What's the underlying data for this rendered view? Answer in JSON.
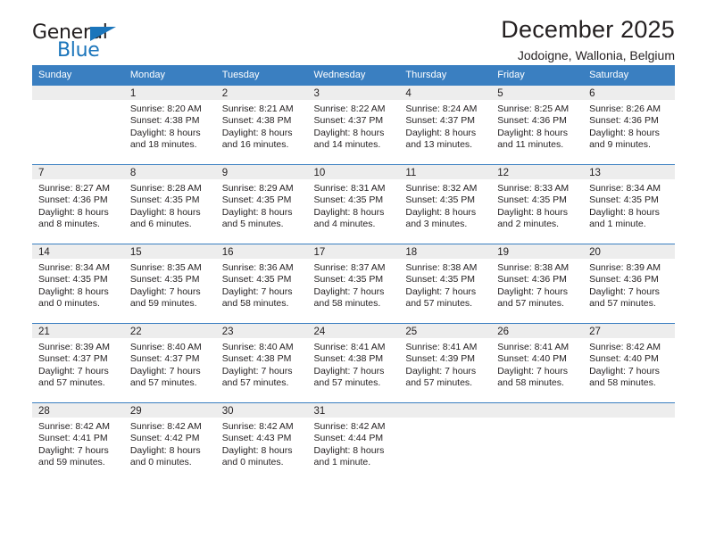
{
  "brand": {
    "name_top": "General",
    "name_bottom": "Blue",
    "triangle_color": "#1b75bb"
  },
  "header": {
    "title": "December 2025",
    "subtitle": "Jodoigne, Wallonia, Belgium"
  },
  "theme": {
    "header_row_bg": "#3a7fc1",
    "daynum_band_bg": "#ededed",
    "text_color": "#231f20"
  },
  "calendar": {
    "weekday_headers": [
      "Sunday",
      "Monday",
      "Tuesday",
      "Wednesday",
      "Thursday",
      "Friday",
      "Saturday"
    ],
    "weeks": [
      [
        {
          "day": "",
          "info": ""
        },
        {
          "day": "1",
          "info": "Sunrise: 8:20 AM\nSunset: 4:38 PM\nDaylight: 8 hours\nand 18 minutes."
        },
        {
          "day": "2",
          "info": "Sunrise: 8:21 AM\nSunset: 4:38 PM\nDaylight: 8 hours\nand 16 minutes."
        },
        {
          "day": "3",
          "info": "Sunrise: 8:22 AM\nSunset: 4:37 PM\nDaylight: 8 hours\nand 14 minutes."
        },
        {
          "day": "4",
          "info": "Sunrise: 8:24 AM\nSunset: 4:37 PM\nDaylight: 8 hours\nand 13 minutes."
        },
        {
          "day": "5",
          "info": "Sunrise: 8:25 AM\nSunset: 4:36 PM\nDaylight: 8 hours\nand 11 minutes."
        },
        {
          "day": "6",
          "info": "Sunrise: 8:26 AM\nSunset: 4:36 PM\nDaylight: 8 hours\nand 9 minutes."
        }
      ],
      [
        {
          "day": "7",
          "info": "Sunrise: 8:27 AM\nSunset: 4:36 PM\nDaylight: 8 hours\nand 8 minutes."
        },
        {
          "day": "8",
          "info": "Sunrise: 8:28 AM\nSunset: 4:35 PM\nDaylight: 8 hours\nand 6 minutes."
        },
        {
          "day": "9",
          "info": "Sunrise: 8:29 AM\nSunset: 4:35 PM\nDaylight: 8 hours\nand 5 minutes."
        },
        {
          "day": "10",
          "info": "Sunrise: 8:31 AM\nSunset: 4:35 PM\nDaylight: 8 hours\nand 4 minutes."
        },
        {
          "day": "11",
          "info": "Sunrise: 8:32 AM\nSunset: 4:35 PM\nDaylight: 8 hours\nand 3 minutes."
        },
        {
          "day": "12",
          "info": "Sunrise: 8:33 AM\nSunset: 4:35 PM\nDaylight: 8 hours\nand 2 minutes."
        },
        {
          "day": "13",
          "info": "Sunrise: 8:34 AM\nSunset: 4:35 PM\nDaylight: 8 hours\nand 1 minute."
        }
      ],
      [
        {
          "day": "14",
          "info": "Sunrise: 8:34 AM\nSunset: 4:35 PM\nDaylight: 8 hours\nand 0 minutes."
        },
        {
          "day": "15",
          "info": "Sunrise: 8:35 AM\nSunset: 4:35 PM\nDaylight: 7 hours\nand 59 minutes."
        },
        {
          "day": "16",
          "info": "Sunrise: 8:36 AM\nSunset: 4:35 PM\nDaylight: 7 hours\nand 58 minutes."
        },
        {
          "day": "17",
          "info": "Sunrise: 8:37 AM\nSunset: 4:35 PM\nDaylight: 7 hours\nand 58 minutes."
        },
        {
          "day": "18",
          "info": "Sunrise: 8:38 AM\nSunset: 4:35 PM\nDaylight: 7 hours\nand 57 minutes."
        },
        {
          "day": "19",
          "info": "Sunrise: 8:38 AM\nSunset: 4:36 PM\nDaylight: 7 hours\nand 57 minutes."
        },
        {
          "day": "20",
          "info": "Sunrise: 8:39 AM\nSunset: 4:36 PM\nDaylight: 7 hours\nand 57 minutes."
        }
      ],
      [
        {
          "day": "21",
          "info": "Sunrise: 8:39 AM\nSunset: 4:37 PM\nDaylight: 7 hours\nand 57 minutes."
        },
        {
          "day": "22",
          "info": "Sunrise: 8:40 AM\nSunset: 4:37 PM\nDaylight: 7 hours\nand 57 minutes."
        },
        {
          "day": "23",
          "info": "Sunrise: 8:40 AM\nSunset: 4:38 PM\nDaylight: 7 hours\nand 57 minutes."
        },
        {
          "day": "24",
          "info": "Sunrise: 8:41 AM\nSunset: 4:38 PM\nDaylight: 7 hours\nand 57 minutes."
        },
        {
          "day": "25",
          "info": "Sunrise: 8:41 AM\nSunset: 4:39 PM\nDaylight: 7 hours\nand 57 minutes."
        },
        {
          "day": "26",
          "info": "Sunrise: 8:41 AM\nSunset: 4:40 PM\nDaylight: 7 hours\nand 58 minutes."
        },
        {
          "day": "27",
          "info": "Sunrise: 8:42 AM\nSunset: 4:40 PM\nDaylight: 7 hours\nand 58 minutes."
        }
      ],
      [
        {
          "day": "28",
          "info": "Sunrise: 8:42 AM\nSunset: 4:41 PM\nDaylight: 7 hours\nand 59 minutes."
        },
        {
          "day": "29",
          "info": "Sunrise: 8:42 AM\nSunset: 4:42 PM\nDaylight: 8 hours\nand 0 minutes."
        },
        {
          "day": "30",
          "info": "Sunrise: 8:42 AM\nSunset: 4:43 PM\nDaylight: 8 hours\nand 0 minutes."
        },
        {
          "day": "31",
          "info": "Sunrise: 8:42 AM\nSunset: 4:44 PM\nDaylight: 8 hours\nand 1 minute."
        },
        {
          "day": "",
          "info": ""
        },
        {
          "day": "",
          "info": ""
        },
        {
          "day": "",
          "info": ""
        }
      ]
    ]
  }
}
